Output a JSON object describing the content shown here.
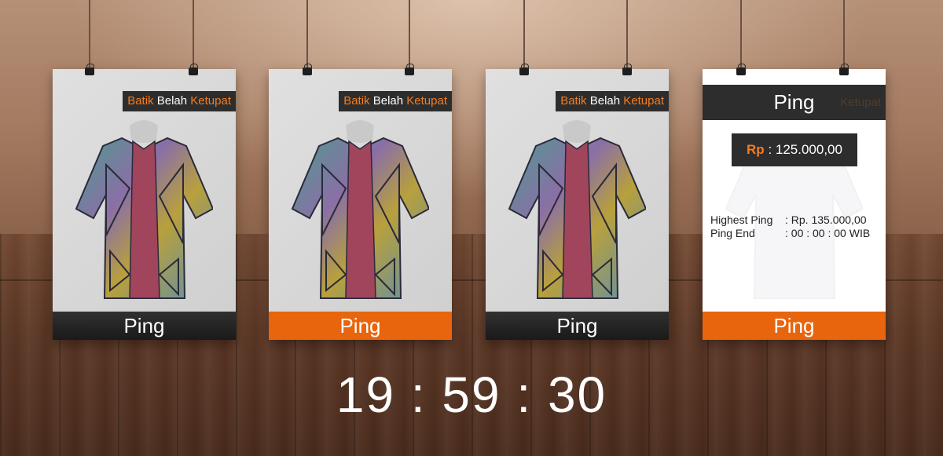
{
  "products": [
    {
      "tag_word1": "Batik",
      "tag_word2": "Belah",
      "tag_word3": "Ketupat",
      "button": "Ping"
    },
    {
      "tag_word1": "Batik",
      "tag_word2": "Belah",
      "tag_word3": "Ketupat",
      "button": "Ping"
    },
    {
      "tag_word1": "Batik",
      "tag_word2": "Belah",
      "tag_word3": "Ketupat",
      "button": "Ping"
    }
  ],
  "detail": {
    "title": "Ping",
    "ghost_tag": "Ketupat",
    "currency": "Rp",
    "price": ": 125.000,00",
    "highest_label": "Highest Ping",
    "highest_value": ": Rp. 135.000,00",
    "end_label": "Ping End",
    "end_value": ": 00 : 00 : 00 WIB",
    "button": "Ping"
  },
  "countdown": "19 : 59 : 30",
  "colors": {
    "accent": "#e8650e",
    "dark": "#2d2d2d"
  },
  "icons": [
    "binder-clip-icon",
    "shirt-image"
  ]
}
